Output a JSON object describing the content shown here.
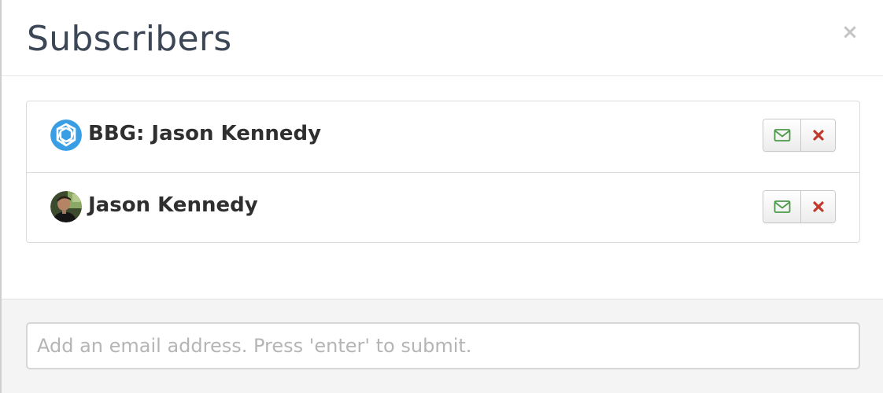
{
  "modal": {
    "title": "Subscribers",
    "close_glyph": "×"
  },
  "subscribers": [
    {
      "name": "BBG: Jason Kennedy",
      "avatar": "bbg-logo-icon",
      "actions": [
        "email-icon",
        "remove-icon"
      ]
    },
    {
      "name": "Jason Kennedy",
      "avatar": "user-photo",
      "actions": [
        "email-icon",
        "remove-icon"
      ]
    }
  ],
  "add_email": {
    "value": "",
    "placeholder": "Add an email address. Press 'enter' to submit."
  },
  "colors": {
    "title": "#3b4656",
    "email_icon": "#4a9a4a",
    "remove_icon": "#c0392b",
    "logo_blue": "#3a9ee4",
    "footer_bg": "#f4f4f4"
  }
}
